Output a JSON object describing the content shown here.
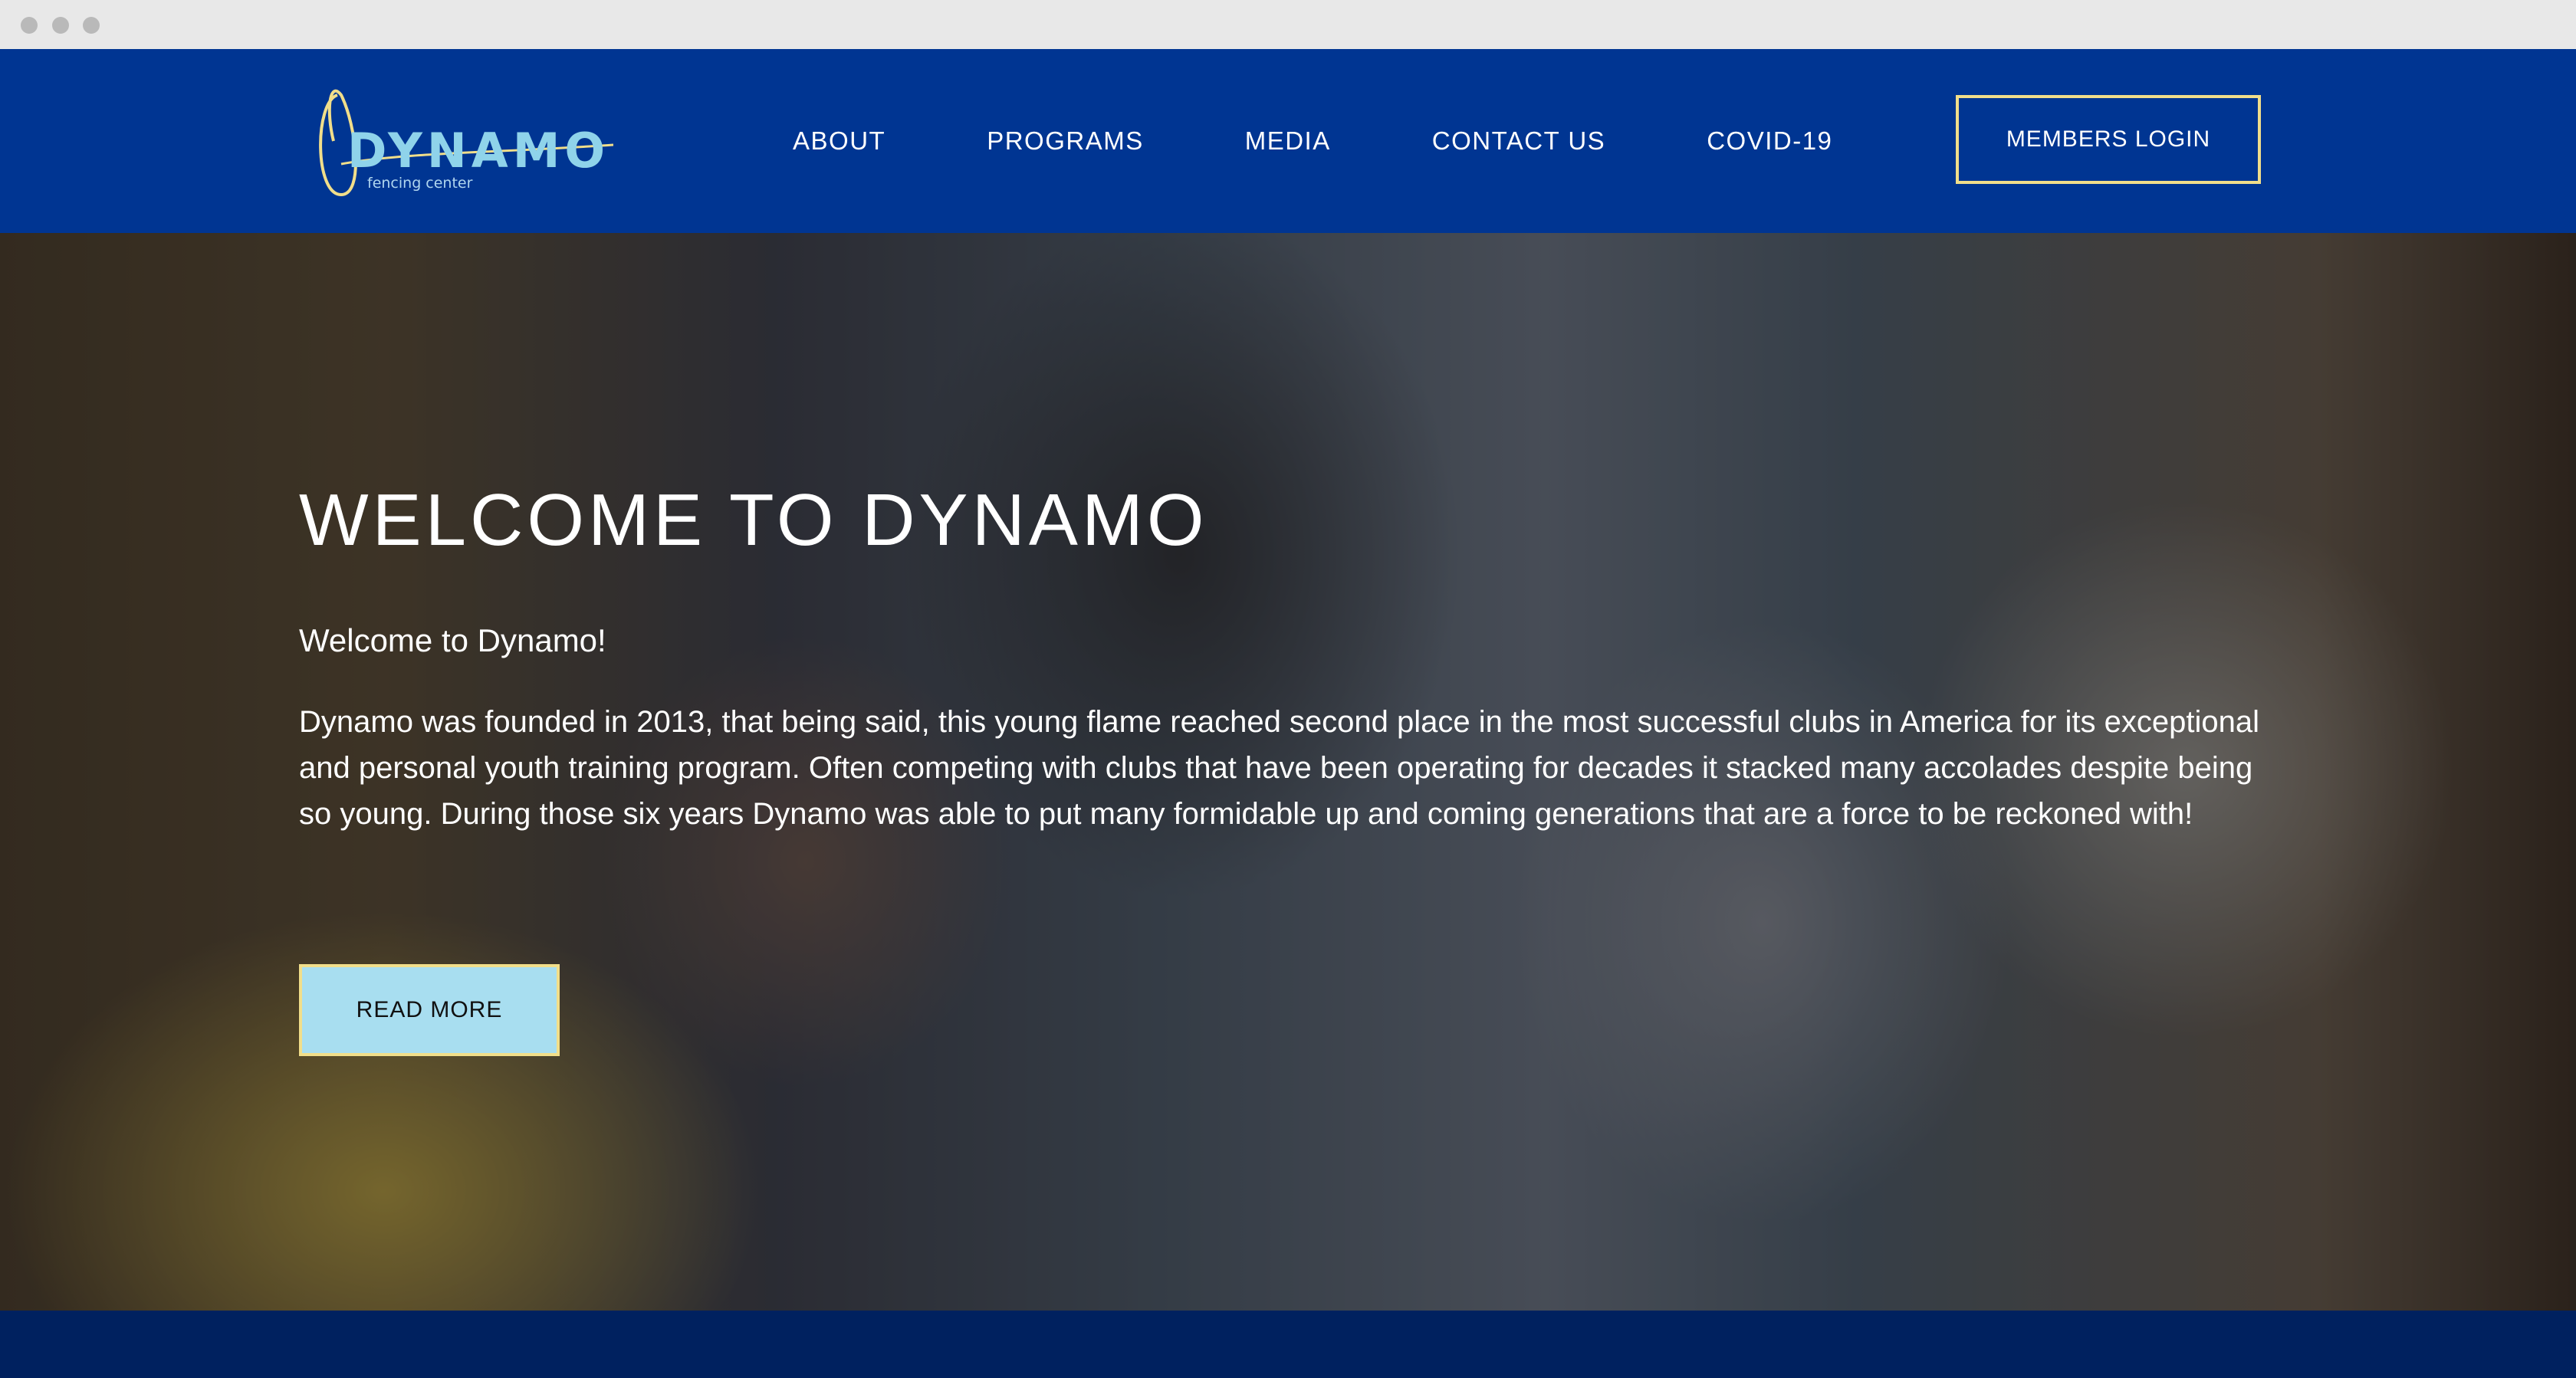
{
  "logo": {
    "name": "DYNAMO",
    "tagline": "fencing center"
  },
  "nav": {
    "items": [
      {
        "label": "ABOUT"
      },
      {
        "label": "PROGRAMS"
      },
      {
        "label": "MEDIA"
      },
      {
        "label": "CONTACT US"
      },
      {
        "label": "COVID-19"
      }
    ],
    "login_label": "MEMBERS LOGIN"
  },
  "hero": {
    "title": "WELCOME TO DYNAMO",
    "subtitle": "Welcome to Dynamo!",
    "body": "Dynamo was founded in 2013, that being said, this young flame reached second place in the most successful clubs in America for its exceptional and personal youth training program. Often competing with clubs that have been operating for decades it stacked many accolades despite being so young. During those six years Dynamo was able to put many formidable up and coming generations that are a force to be reckoned with!",
    "read_more_label": "READ MORE"
  },
  "colors": {
    "nav_bg": "#003592",
    "accent_border": "#f1de8a",
    "button_bg": "#a8def0",
    "footer_bg": "#00215f"
  }
}
